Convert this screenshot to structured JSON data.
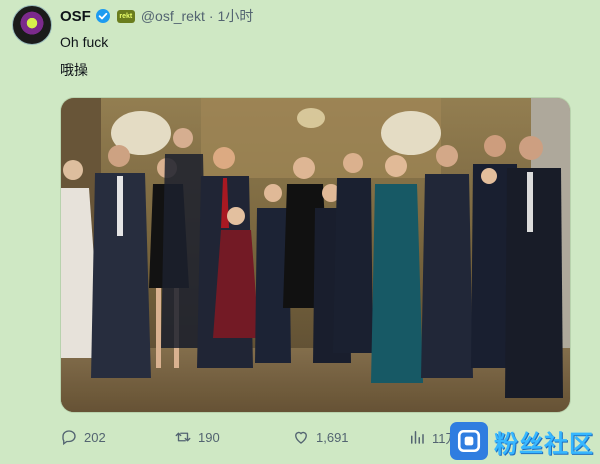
{
  "tweet": {
    "display_name": "OSF",
    "affiliate_badge_text": "rekt",
    "handle": "@osf_rekt",
    "separator": "·",
    "time": "1小时",
    "text_line1": "Oh fuck",
    "text_line2": "哦操",
    "photo_alt": "group photo"
  },
  "actions": {
    "replies": "202",
    "retweets": "190",
    "likes": "1,691",
    "views": "11万"
  },
  "watermark": {
    "text": "粉丝社区"
  },
  "colors": {
    "background": "#cfe8c4",
    "verified": "#1d9bf0",
    "muted": "#536471",
    "watermark": "#37b7ff"
  }
}
